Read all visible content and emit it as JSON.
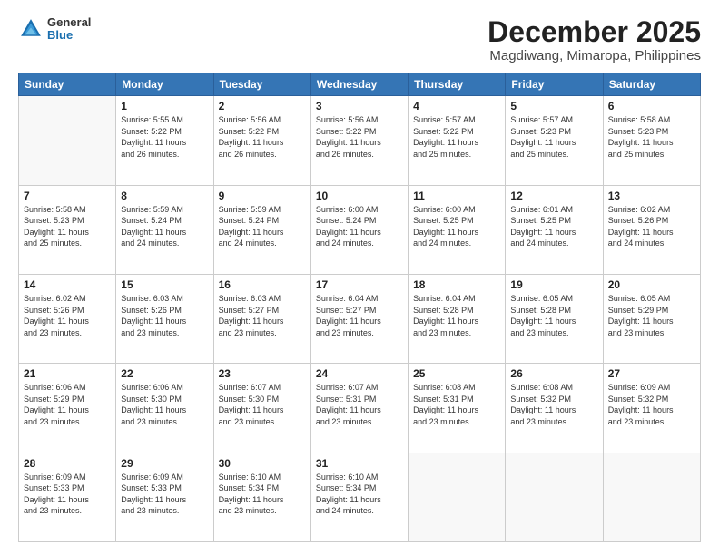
{
  "header": {
    "logo": {
      "general": "General",
      "blue": "Blue"
    },
    "title": "December 2025",
    "subtitle": "Magdiwang, Mimaropa, Philippines"
  },
  "weekdays": [
    "Sunday",
    "Monday",
    "Tuesday",
    "Wednesday",
    "Thursday",
    "Friday",
    "Saturday"
  ],
  "weeks": [
    [
      {
        "day": "",
        "info": ""
      },
      {
        "day": "1",
        "info": "Sunrise: 5:55 AM\nSunset: 5:22 PM\nDaylight: 11 hours\nand 26 minutes."
      },
      {
        "day": "2",
        "info": "Sunrise: 5:56 AM\nSunset: 5:22 PM\nDaylight: 11 hours\nand 26 minutes."
      },
      {
        "day": "3",
        "info": "Sunrise: 5:56 AM\nSunset: 5:22 PM\nDaylight: 11 hours\nand 26 minutes."
      },
      {
        "day": "4",
        "info": "Sunrise: 5:57 AM\nSunset: 5:22 PM\nDaylight: 11 hours\nand 25 minutes."
      },
      {
        "day": "5",
        "info": "Sunrise: 5:57 AM\nSunset: 5:23 PM\nDaylight: 11 hours\nand 25 minutes."
      },
      {
        "day": "6",
        "info": "Sunrise: 5:58 AM\nSunset: 5:23 PM\nDaylight: 11 hours\nand 25 minutes."
      }
    ],
    [
      {
        "day": "7",
        "info": "Sunrise: 5:58 AM\nSunset: 5:23 PM\nDaylight: 11 hours\nand 25 minutes."
      },
      {
        "day": "8",
        "info": "Sunrise: 5:59 AM\nSunset: 5:24 PM\nDaylight: 11 hours\nand 24 minutes."
      },
      {
        "day": "9",
        "info": "Sunrise: 5:59 AM\nSunset: 5:24 PM\nDaylight: 11 hours\nand 24 minutes."
      },
      {
        "day": "10",
        "info": "Sunrise: 6:00 AM\nSunset: 5:24 PM\nDaylight: 11 hours\nand 24 minutes."
      },
      {
        "day": "11",
        "info": "Sunrise: 6:00 AM\nSunset: 5:25 PM\nDaylight: 11 hours\nand 24 minutes."
      },
      {
        "day": "12",
        "info": "Sunrise: 6:01 AM\nSunset: 5:25 PM\nDaylight: 11 hours\nand 24 minutes."
      },
      {
        "day": "13",
        "info": "Sunrise: 6:02 AM\nSunset: 5:26 PM\nDaylight: 11 hours\nand 24 minutes."
      }
    ],
    [
      {
        "day": "14",
        "info": "Sunrise: 6:02 AM\nSunset: 5:26 PM\nDaylight: 11 hours\nand 23 minutes."
      },
      {
        "day": "15",
        "info": "Sunrise: 6:03 AM\nSunset: 5:26 PM\nDaylight: 11 hours\nand 23 minutes."
      },
      {
        "day": "16",
        "info": "Sunrise: 6:03 AM\nSunset: 5:27 PM\nDaylight: 11 hours\nand 23 minutes."
      },
      {
        "day": "17",
        "info": "Sunrise: 6:04 AM\nSunset: 5:27 PM\nDaylight: 11 hours\nand 23 minutes."
      },
      {
        "day": "18",
        "info": "Sunrise: 6:04 AM\nSunset: 5:28 PM\nDaylight: 11 hours\nand 23 minutes."
      },
      {
        "day": "19",
        "info": "Sunrise: 6:05 AM\nSunset: 5:28 PM\nDaylight: 11 hours\nand 23 minutes."
      },
      {
        "day": "20",
        "info": "Sunrise: 6:05 AM\nSunset: 5:29 PM\nDaylight: 11 hours\nand 23 minutes."
      }
    ],
    [
      {
        "day": "21",
        "info": "Sunrise: 6:06 AM\nSunset: 5:29 PM\nDaylight: 11 hours\nand 23 minutes."
      },
      {
        "day": "22",
        "info": "Sunrise: 6:06 AM\nSunset: 5:30 PM\nDaylight: 11 hours\nand 23 minutes."
      },
      {
        "day": "23",
        "info": "Sunrise: 6:07 AM\nSunset: 5:30 PM\nDaylight: 11 hours\nand 23 minutes."
      },
      {
        "day": "24",
        "info": "Sunrise: 6:07 AM\nSunset: 5:31 PM\nDaylight: 11 hours\nand 23 minutes."
      },
      {
        "day": "25",
        "info": "Sunrise: 6:08 AM\nSunset: 5:31 PM\nDaylight: 11 hours\nand 23 minutes."
      },
      {
        "day": "26",
        "info": "Sunrise: 6:08 AM\nSunset: 5:32 PM\nDaylight: 11 hours\nand 23 minutes."
      },
      {
        "day": "27",
        "info": "Sunrise: 6:09 AM\nSunset: 5:32 PM\nDaylight: 11 hours\nand 23 minutes."
      }
    ],
    [
      {
        "day": "28",
        "info": "Sunrise: 6:09 AM\nSunset: 5:33 PM\nDaylight: 11 hours\nand 23 minutes."
      },
      {
        "day": "29",
        "info": "Sunrise: 6:09 AM\nSunset: 5:33 PM\nDaylight: 11 hours\nand 23 minutes."
      },
      {
        "day": "30",
        "info": "Sunrise: 6:10 AM\nSunset: 5:34 PM\nDaylight: 11 hours\nand 23 minutes."
      },
      {
        "day": "31",
        "info": "Sunrise: 6:10 AM\nSunset: 5:34 PM\nDaylight: 11 hours\nand 24 minutes."
      },
      {
        "day": "",
        "info": ""
      },
      {
        "day": "",
        "info": ""
      },
      {
        "day": "",
        "info": ""
      }
    ]
  ]
}
